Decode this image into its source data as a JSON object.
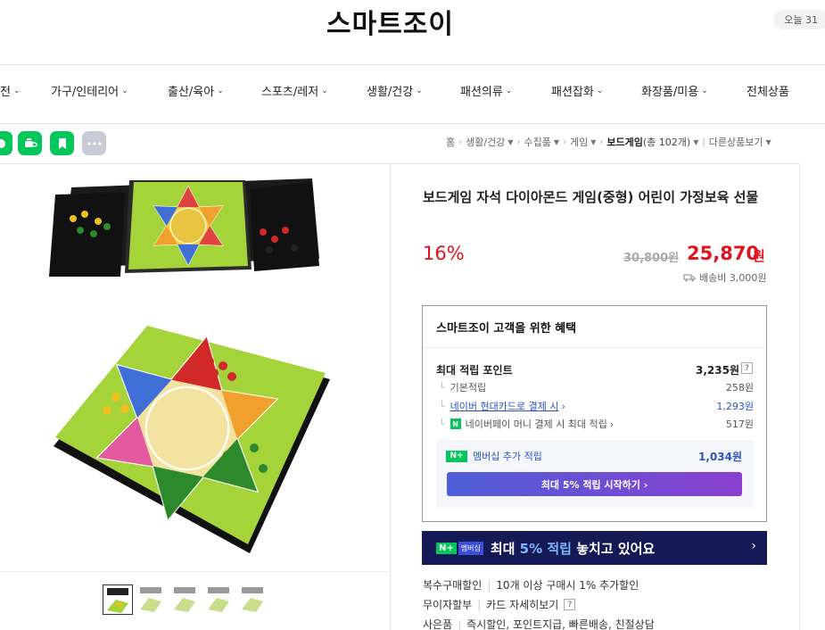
{
  "header": {
    "store_name": "스마트조이",
    "today_badge": "오늘 31"
  },
  "nav": {
    "items": [
      {
        "label": "전"
      },
      {
        "label": "가구/인테리어"
      },
      {
        "label": "출산/육아"
      },
      {
        "label": "스포츠/레저"
      },
      {
        "label": "생활/건강"
      },
      {
        "label": "패션의류"
      },
      {
        "label": "패션잡화"
      },
      {
        "label": "화장품/미용"
      },
      {
        "label": "전체상품"
      }
    ]
  },
  "share_icons": [
    "talk-icon",
    "cafe-icon",
    "bookmark-icon",
    "more-icon"
  ],
  "breadcrumb": {
    "home": "홈",
    "level1": "생활/건강",
    "level2": "수집품",
    "level3": "게임",
    "current": "보드게임",
    "current_count": "(총 102개)",
    "other": "다른상품보기"
  },
  "product": {
    "title": "보드게임 자석 다이아몬드 게임(중형) 어린이 가정보육 선물",
    "discount": "16%",
    "original_price": "30,800원",
    "sale_price": "25,870",
    "sale_unit": "원",
    "shipping": "배송비 3,000원"
  },
  "benefits": {
    "title": "스마트조이 고객을 위한 혜택",
    "max_points_label": "최대 적립 포인트",
    "max_points_value": "3,235원",
    "rows": [
      {
        "label": "기본적립",
        "value": "258원"
      },
      {
        "label": "네이버 현대카드로 결제 시",
        "value": "1,293원"
      },
      {
        "label": "네이버페이 머니 결제 시 최대 적립",
        "value": "517원"
      }
    ],
    "membership_label": "멤버십 추가 적립",
    "membership_value": "1,034원",
    "membership_button": "최대 5% 적립 시작하기 ›"
  },
  "banner": {
    "tag_member": "멤버십",
    "text_prefix": "최대 ",
    "text_highlight": "5% 적립",
    "text_suffix": " 놓치고 있어요"
  },
  "info": {
    "multi_buy_label": "복수구매할인",
    "multi_buy_value": "10개 이상 구매시 1% 추가할인",
    "installment_label": "무이자할부",
    "installment_value": "카드 자세히보기",
    "gift_label": "사은품",
    "gift_value": "즉시할인, 포인트지급, 빠른배송, 친절상담"
  },
  "colors": {
    "accent_red": "#e0141e",
    "naver_green": "#03c75a",
    "banner_navy": "#151a57",
    "link_blue": "#2a53c6"
  }
}
